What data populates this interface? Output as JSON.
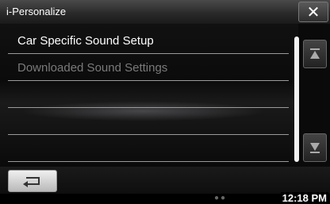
{
  "window": {
    "title": "i-Personalize"
  },
  "list": {
    "items": [
      {
        "label": "Car Specific Sound Setup",
        "enabled": true
      },
      {
        "label": "Downloaded Sound Settings",
        "enabled": false
      },
      {
        "label": "",
        "enabled": false
      },
      {
        "label": "",
        "enabled": false
      },
      {
        "label": "",
        "enabled": false
      }
    ]
  },
  "icons": {
    "close": "close-icon",
    "scroll_up": "scroll-up-icon",
    "scroll_down": "scroll-down-icon",
    "back": "back-arrow-icon",
    "status": "status-icons"
  },
  "status": {
    "time": "12:18 PM"
  },
  "colors": {
    "titlebar": "#3a3a3a",
    "background": "#000000",
    "disabled_text": "#7a7a7a"
  }
}
